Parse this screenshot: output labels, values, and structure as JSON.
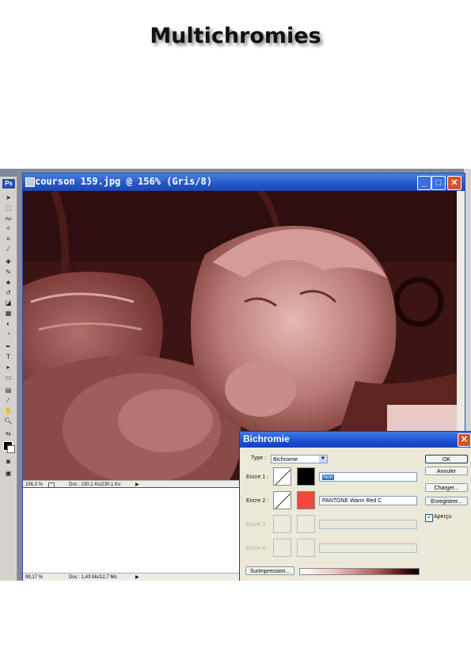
{
  "page": {
    "heading": "Multichromies"
  },
  "document": {
    "title": "courson 159.jpg @ 156% (Gris/8)",
    "zoom": "156,3 %",
    "doc_info": "Doc : 230,1 Ko/230,1 Ko"
  },
  "document2": {
    "zoom": "99,17 %",
    "doc_info": "Doc : 1,43 Mo/12,7 Mo"
  },
  "toolbox": {
    "badge": "Ps"
  },
  "dialog": {
    "title": "Bichromie",
    "type_label": "Type :",
    "type_value": "Bichromie",
    "inks": [
      {
        "label": "Encre 1 :",
        "name": "Noir",
        "color": "#000000",
        "enabled": true
      },
      {
        "label": "Encre 2 :",
        "name": "PANTONE Warm Red C",
        "color": "#f2473a",
        "enabled": true
      },
      {
        "label": "Encre 3 :",
        "name": "",
        "color": "",
        "enabled": false
      },
      {
        "label": "Encre 4 :",
        "name": "",
        "color": "",
        "enabled": false
      }
    ],
    "buttons": {
      "ok": "OK",
      "cancel": "Annuler",
      "load": "Charger...",
      "save": "Enregistrer...",
      "overprint": "Surimpression..."
    },
    "preview_label": "Aperçu",
    "preview_checked": true
  },
  "colors": {
    "tint": "#5a2222",
    "dialog_bg": "#ece9d8",
    "titlebar": "#2456c6"
  }
}
